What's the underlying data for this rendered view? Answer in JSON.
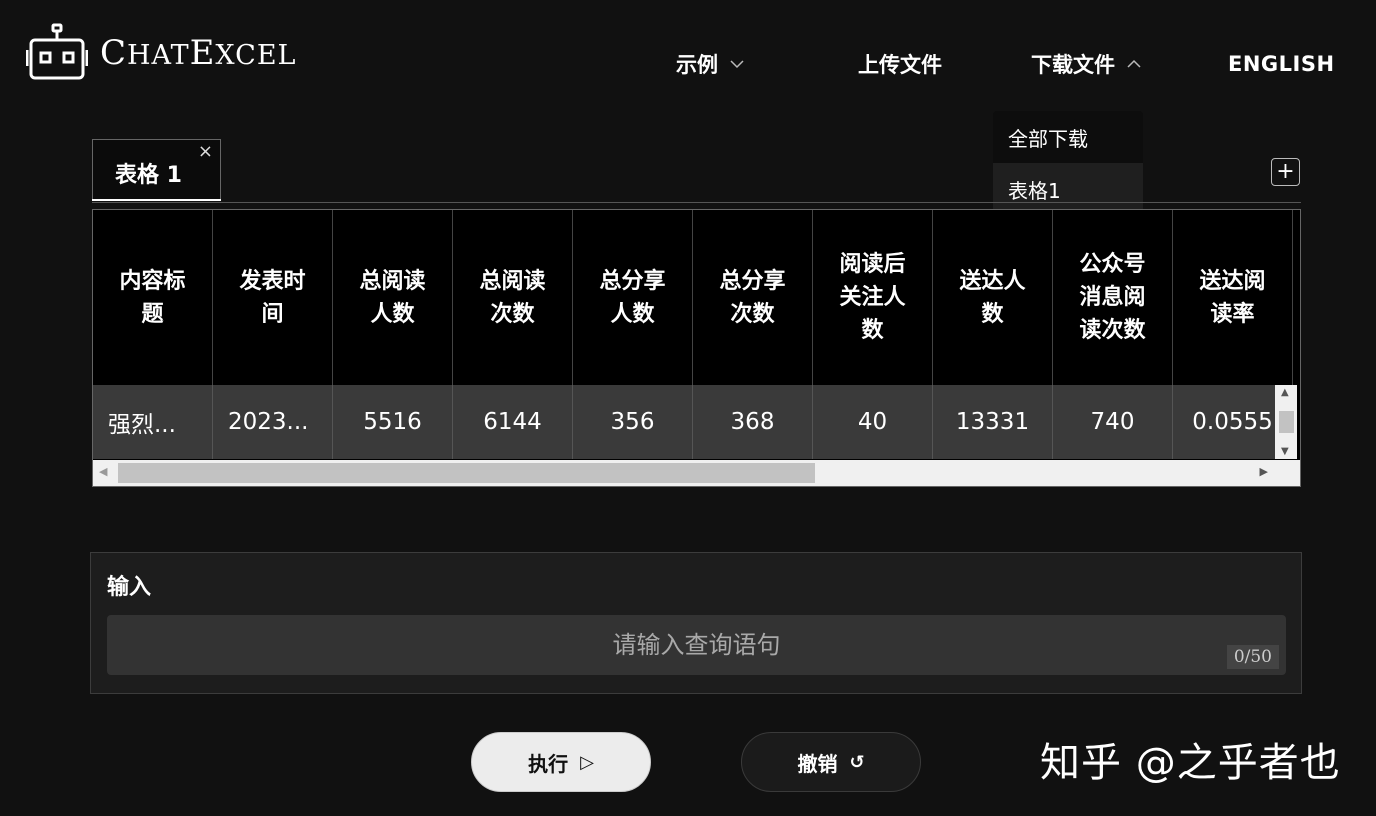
{
  "app": {
    "logo_main": "C",
    "logo_rest": "HAT",
    "logo_main2": "E",
    "logo_rest2": "XCEL"
  },
  "nav": {
    "examples": "示例",
    "upload": "上传文件",
    "download": "下载文件",
    "english": "ENGLISH"
  },
  "download_menu": {
    "items": [
      "全部下载",
      "表格1"
    ]
  },
  "tabs": {
    "active": "表格 1",
    "close": "×",
    "add": "+"
  },
  "table": {
    "headers": [
      "内容标题",
      "发表时间",
      "总阅读人数",
      "总阅读次数",
      "总分享人数",
      "总分享次数",
      "阅读后关注人数",
      "送达人数",
      "公众号消息阅读次数",
      "送达阅读率"
    ],
    "rows": [
      [
        "强烈...",
        "2023...",
        "5516",
        "6144",
        "356",
        "368",
        "40",
        "13331",
        "740",
        "0.0555"
      ]
    ]
  },
  "input_panel": {
    "label": "输入",
    "placeholder": "请输入查询语句",
    "value": "",
    "counter": "0/50"
  },
  "buttons": {
    "run": "执行",
    "undo": "撤销"
  },
  "watermark": "知乎 @之乎者也"
}
